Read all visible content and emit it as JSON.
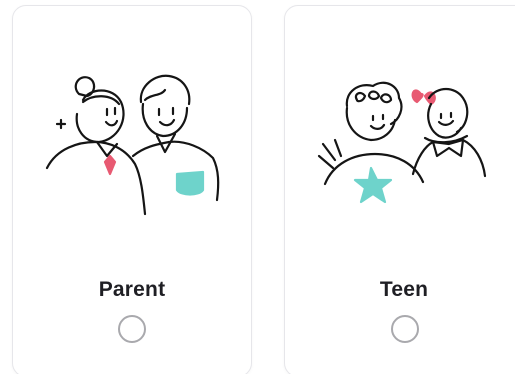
{
  "options": [
    {
      "label": "Parent",
      "selected": false
    },
    {
      "label": "Teen",
      "selected": false
    }
  ],
  "colors": {
    "accent_teal": "#6ed3cb",
    "accent_pink": "#e85a72",
    "line": "#151515",
    "radio_border": "#a9a9ad"
  },
  "icons": {
    "parent": "parent-couple-illustration",
    "teen": "teen-kids-illustration"
  }
}
